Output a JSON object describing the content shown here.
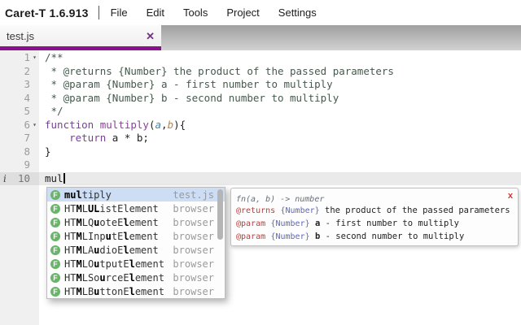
{
  "window": {
    "title": "Caret-T 1.6.913"
  },
  "menu": {
    "items": [
      "File",
      "Edit",
      "Tools",
      "Project",
      "Settings"
    ]
  },
  "tab": {
    "name": "test.js",
    "close_label": "✕"
  },
  "editor": {
    "lines": [
      {
        "num": 1,
        "fold": true,
        "tokens": [
          [
            "comment",
            "/**"
          ]
        ]
      },
      {
        "num": 2,
        "tokens": [
          [
            "comment",
            " * @returns {Number} the product of the passed parameters"
          ]
        ]
      },
      {
        "num": 3,
        "tokens": [
          [
            "comment",
            " * @param {Number} a - first number to multiply"
          ]
        ]
      },
      {
        "num": 4,
        "tokens": [
          [
            "comment",
            " * @param {Number} b - second number to multiply"
          ]
        ]
      },
      {
        "num": 5,
        "tokens": [
          [
            "comment",
            " */"
          ]
        ]
      },
      {
        "num": 6,
        "fold": true,
        "tokens": [
          [
            "kw",
            "function"
          ],
          [
            "pl",
            " "
          ],
          [
            "fn",
            "multiply"
          ],
          [
            "pl",
            "("
          ],
          [
            "pa",
            "a"
          ],
          [
            "pl",
            ","
          ],
          [
            "pb",
            "b"
          ],
          [
            "pl",
            "){"
          ]
        ]
      },
      {
        "num": 7,
        "tokens": [
          [
            "pl",
            "    "
          ],
          [
            "kw",
            "return"
          ],
          [
            "pl",
            " a * b;"
          ]
        ]
      },
      {
        "num": 8,
        "tokens": [
          [
            "pl",
            "}"
          ]
        ]
      },
      {
        "num": 9,
        "tokens": []
      },
      {
        "num": 10,
        "active": true,
        "info_marker": "i",
        "cursor": true,
        "tokens": [
          [
            "pl",
            "mul"
          ]
        ]
      }
    ]
  },
  "autocomplete": {
    "items": [
      {
        "label": "multiply",
        "bold": [
          0,
          1,
          2
        ],
        "meta": "test.js",
        "kind": "F",
        "selected": true
      },
      {
        "label": "HTMLUListElement",
        "bold": [
          2,
          4,
          5
        ],
        "meta": "browser",
        "kind": "F"
      },
      {
        "label": "HTMLQuoteElement",
        "bold": [
          2,
          5,
          10
        ],
        "meta": "browser",
        "kind": "F"
      },
      {
        "label": "HTMLInputElement",
        "bold": [
          2,
          7,
          10
        ],
        "meta": "browser",
        "kind": "F"
      },
      {
        "label": "HTMLAudioElement",
        "bold": [
          2,
          5,
          10
        ],
        "meta": "browser",
        "kind": "F"
      },
      {
        "label": "HTMLOutputElement",
        "bold": [
          2,
          5,
          11
        ],
        "meta": "browser",
        "kind": "F"
      },
      {
        "label": "HTMLSourceElement",
        "bold": [
          2,
          6,
          11
        ],
        "meta": "browser",
        "kind": "F"
      },
      {
        "label": "HTMLButtonElement",
        "bold": [
          2,
          5,
          11
        ],
        "meta": "browser",
        "kind": "F"
      }
    ]
  },
  "tooltip": {
    "signature": "fn(a, b) -> number",
    "close_label": "x",
    "lines": [
      [
        [
          "tag",
          "@returns"
        ],
        [
          "pl",
          " "
        ],
        [
          "type",
          "{Number}"
        ],
        [
          "pl",
          " the product of the passed parameters"
        ]
      ],
      [
        [
          "tag",
          "@param"
        ],
        [
          "pl",
          " "
        ],
        [
          "type",
          "{Number}"
        ],
        [
          "pl",
          " "
        ],
        [
          "name",
          "a"
        ],
        [
          "pl",
          " - first number to multiply"
        ]
      ],
      [
        [
          "tag",
          "@param"
        ],
        [
          "pl",
          " "
        ],
        [
          "type",
          "{Number}"
        ],
        [
          "pl",
          " "
        ],
        [
          "name",
          "b"
        ],
        [
          "pl",
          " - second number to multiply"
        ]
      ]
    ]
  },
  "colors": {
    "accent_purple": "#8c0f8c",
    "keyword_purple": "#7a3e9d",
    "comment_green": "#465a4e",
    "param_a_teal": "#3f87a0",
    "param_b_orange": "#c5823f",
    "selection_blue": "#ccddf4",
    "function_icon_green": "#69b36b",
    "doc_tag_red": "#b0413e",
    "doc_type_blue": "#5a67c8",
    "close_red": "#d8342c"
  }
}
